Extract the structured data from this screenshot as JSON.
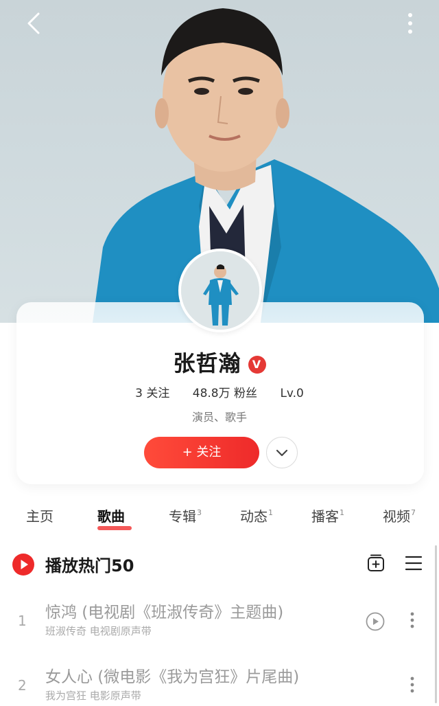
{
  "header": {
    "back_icon": "chevron-left-icon",
    "more_icon": "more-vertical-icon"
  },
  "profile": {
    "name": "张哲瀚",
    "verified_badge": "V",
    "following": "3 关注",
    "fans": "48.8万 粉丝",
    "level": "Lv.0",
    "tags": "演员、歌手",
    "follow_label": "+ 关注",
    "colors": {
      "accent": "#ee2a2a",
      "jacket": "#1f8fc2"
    }
  },
  "tabs": [
    {
      "label": "主页",
      "count": ""
    },
    {
      "label": "歌曲",
      "count": ""
    },
    {
      "label": "专辑",
      "count": "3"
    },
    {
      "label": "动态",
      "count": "1"
    },
    {
      "label": "播客",
      "count": "1"
    },
    {
      "label": "视频",
      "count": "7"
    }
  ],
  "song_list": {
    "title": "播放热门50",
    "songs": [
      {
        "index": "1",
        "title": "惊鸿 (电视剧《班淑传奇》主题曲)",
        "subtitle": "班淑传奇 电视剧原声带",
        "has_mv": true
      },
      {
        "index": "2",
        "title": "女人心 (微电影《我为宫狂》片尾曲)",
        "subtitle": "我为宫狂 电影原声带",
        "has_mv": false
      }
    ]
  }
}
